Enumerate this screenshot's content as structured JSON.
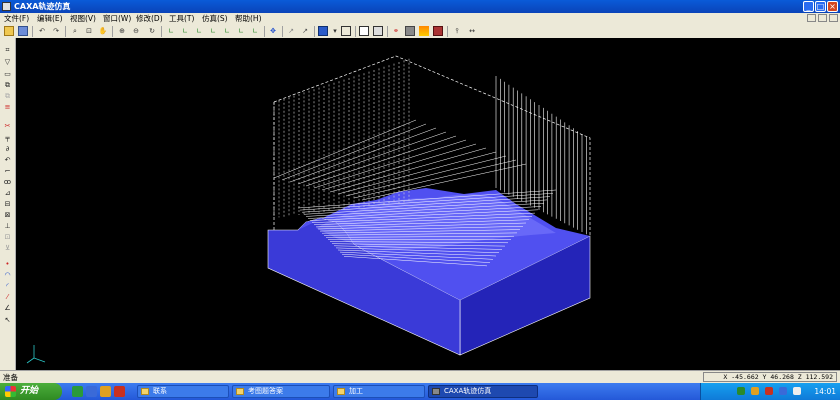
{
  "window": {
    "title": "CAXA轨迹仿真"
  },
  "window_controls": {
    "minimize": "_",
    "maximize": "□",
    "close": "×"
  },
  "menu": [
    {
      "label": "文件(F)"
    },
    {
      "label": "编辑(E)"
    },
    {
      "label": "视图(V)"
    },
    {
      "label": "窗口(W)"
    },
    {
      "label": "修改(D)"
    },
    {
      "label": "工具(T)"
    },
    {
      "label": "仿真(S)"
    },
    {
      "label": "帮助(H)"
    }
  ],
  "toolbar_icons": [
    "open-icon",
    "save-icon",
    "undo-icon",
    "redo-icon",
    "zoom-window-icon",
    "zoom-fit-icon",
    "pan-icon",
    "rotate-icon",
    "zoom-in-icon",
    "zoom-out-icon",
    "refresh-icon",
    "view-front-icon",
    "view-back-icon",
    "view-left-icon",
    "view-right-icon",
    "view-top-icon",
    "view-bottom-icon",
    "view-iso-icon",
    "view-iso2-icon",
    "move-icon",
    "select-icon",
    "pick-icon",
    "render-mode-icon",
    "wireframe-icon",
    "frame-icon",
    "shade-icon",
    "path-icon",
    "layer-icon",
    "color-icon",
    "material-icon",
    "measure-icon",
    "distance-icon"
  ],
  "left_tool_icons": [
    "select-box-icon",
    "select-poly-icon",
    "box-icon",
    "copy-icon",
    "paste-icon",
    "delete-icon",
    "cut-icon",
    "trim-icon",
    "offset-icon",
    "arc-icon",
    "link-icon",
    "chain-icon",
    "extend-icon",
    "split-icon",
    "join-icon",
    "break-icon",
    "blank1-icon",
    "blank2-icon",
    "point-icon",
    "circle-icon",
    "arc-tool-icon",
    "line-tool-icon",
    "angle-icon",
    "cursor-icon"
  ],
  "status": {
    "prompt": "准备",
    "coords": "X  -45.662  Y   46.268  Z  112.592"
  },
  "taskbar": {
    "start_label": "开始",
    "tasks": [
      {
        "label": "联系"
      },
      {
        "label": "考图题答案"
      },
      {
        "label": "加工"
      },
      {
        "label": "CAXA轨迹仿真",
        "active": true
      }
    ],
    "clock": "14:01"
  },
  "colors": {
    "stock_top": "#5050f0",
    "stock_front": "#3a3ad8",
    "stock_side": "#2424b8",
    "toolpath": "#ffffff",
    "background": "#000000"
  }
}
